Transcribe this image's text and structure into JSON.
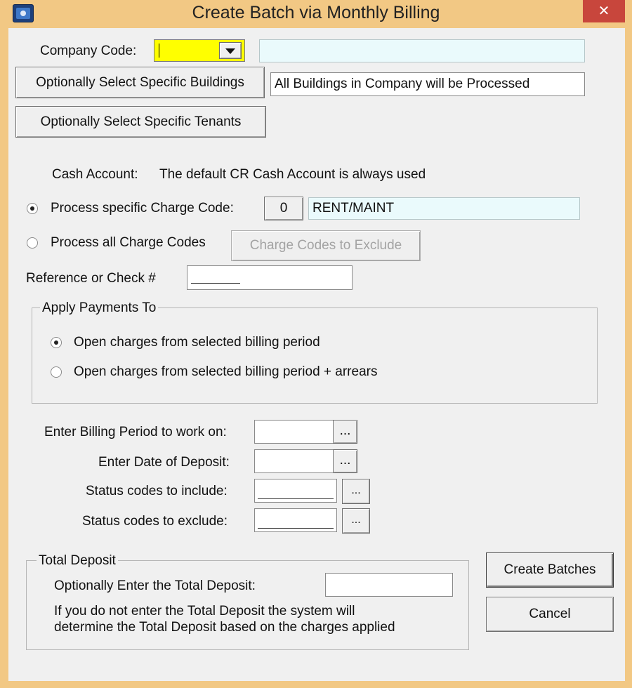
{
  "window": {
    "title": "Create Batch via Monthly Billing",
    "close_glyph": "✕"
  },
  "company": {
    "label": "Company Code:",
    "code_value": "",
    "code_bg": "#ffff00",
    "name_value": ""
  },
  "buildings": {
    "button": "Optionally Select Specific Buildings",
    "status": "All Buildings in Company will be Processed"
  },
  "tenants": {
    "button": "Optionally Select Specific Tenants"
  },
  "cash_account": {
    "label": "Cash Account:",
    "text": "The default CR Cash Account is always used"
  },
  "charge_code": {
    "specific_label": "Process specific Charge Code:",
    "specific_selected": true,
    "code": "0",
    "code_name": "RENT/MAINT",
    "all_label": "Process all Charge Codes",
    "all_selected": false,
    "exclude_button": "Charge Codes to Exclude"
  },
  "reference": {
    "label": "Reference or Check #",
    "value": ""
  },
  "apply_payments": {
    "title": "Apply Payments To",
    "options": [
      {
        "label": "Open charges from selected billing period",
        "selected": true
      },
      {
        "label": "Open charges from selected billing period + arrears",
        "selected": false
      }
    ]
  },
  "billing_period": {
    "label": "Enter Billing Period to work on:",
    "value": "",
    "button": "..."
  },
  "deposit_date": {
    "label": "Enter Date of Deposit:",
    "value": "",
    "button": "..."
  },
  "status_include": {
    "label": "Status codes to include:",
    "value": "",
    "button": "..."
  },
  "status_exclude": {
    "label": "Status codes to exclude:",
    "value": "",
    "button": "..."
  },
  "total_deposit": {
    "title": "Total Deposit",
    "label": "Optionally Enter the Total Deposit:",
    "value": "",
    "note_line1": "If you do not enter the Total Deposit the system will",
    "note_line2": "determine the Total Deposit based on the charges applied"
  },
  "actions": {
    "create": "Create Batches",
    "cancel": "Cancel"
  },
  "colors": {
    "frame": "#f2c884",
    "client": "#f0f0f0",
    "close": "#c8463c",
    "field_cyan": "#eafafc",
    "company_code": "#ffff00"
  }
}
